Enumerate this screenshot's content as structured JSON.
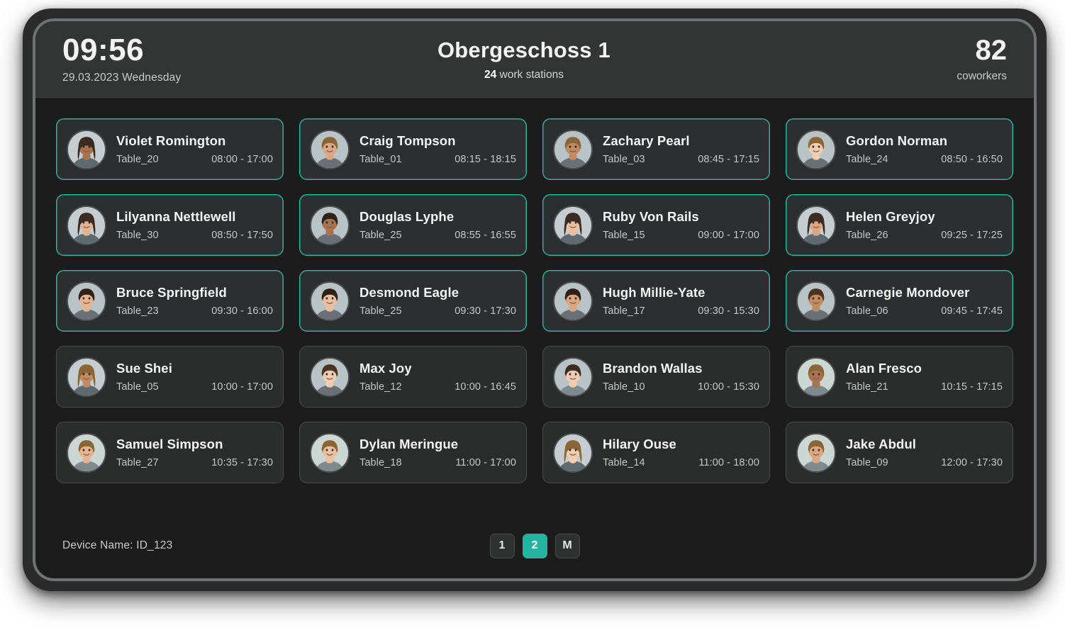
{
  "theme": {
    "accent": "#25b3a2",
    "screen_bg": "#1c1c1c",
    "header_bg": "#333434",
    "card_bg": "#2b2c2c",
    "card_border": "#4a4b4b",
    "text_primary": "#f2f2f2",
    "text_secondary": "#c9cacb"
  },
  "header": {
    "clock": "09:56",
    "date": "29.03.2023 Wednesday",
    "floor_title": "Obergeschoss 1",
    "stations_count": "24",
    "stations_suffix": " work stations",
    "coworkers_count": "82",
    "coworkers_label": "coworkers"
  },
  "footer": {
    "device_name": "Device Name: ID_123",
    "pager": [
      {
        "label": "1",
        "active": false
      },
      {
        "label": "2",
        "active": true
      },
      {
        "label": "M",
        "active": false
      }
    ]
  },
  "cards": [
    {
      "name": "Violet Romington",
      "table": "Table_20",
      "time": "08:00 - 17:00",
      "active": true,
      "avatar": "female-1"
    },
    {
      "name": "Craig Tompson",
      "table": "Table_01",
      "time": "08:15 - 18:15",
      "active": true,
      "avatar": "male-1"
    },
    {
      "name": "Zachary Pearl",
      "table": "Table_03",
      "time": "08:45 - 17:15",
      "active": true,
      "avatar": "male-2"
    },
    {
      "name": "Gordon Norman",
      "table": "Table_24",
      "time": "08:50 - 16:50",
      "active": true,
      "avatar": "male-3"
    },
    {
      "name": "Lilyanna Nettlewell",
      "table": "Table_30",
      "time": "08:50 - 17:50",
      "active": true,
      "avatar": "female-2"
    },
    {
      "name": "Douglas Lyphe",
      "table": "Table_25",
      "time": "08:55 - 16:55",
      "active": true,
      "avatar": "male-4"
    },
    {
      "name": "Ruby Von Rails",
      "table": "Table_15",
      "time": "09:00 - 17:00",
      "active": true,
      "avatar": "female-3"
    },
    {
      "name": "Helen Greyjoy",
      "table": "Table_26",
      "time": "09:25 - 17:25",
      "active": true,
      "avatar": "female-4"
    },
    {
      "name": "Bruce Springfield",
      "table": "Table_23",
      "time": "09:30 - 16:00",
      "active": true,
      "avatar": "male-5"
    },
    {
      "name": "Desmond Eagle",
      "table": "Table_25",
      "time": "09:30 - 17:30",
      "active": true,
      "avatar": "male-6"
    },
    {
      "name": "Hugh Millie-Yate",
      "table": "Table_17",
      "time": "09:30 - 15:30",
      "active": true,
      "avatar": "male-7"
    },
    {
      "name": "Carnegie Mondover",
      "table": "Table_06",
      "time": "09:45 - 17:45",
      "active": true,
      "avatar": "male-8"
    },
    {
      "name": "Sue Shei",
      "table": "Table_05",
      "time": "10:00 - 17:00",
      "active": false,
      "avatar": "female-5"
    },
    {
      "name": "Max Joy",
      "table": "Table_12",
      "time": "10:00 - 16:45",
      "active": false,
      "avatar": "male-9"
    },
    {
      "name": "Brandon Wallas",
      "table": "Table_10",
      "time": "10:00 - 15:30",
      "active": false,
      "avatar": "male-10"
    },
    {
      "name": "Alan Fresco",
      "table": "Table_21",
      "time": "10:15 - 17:15",
      "active": false,
      "avatar": "male-11"
    },
    {
      "name": "Samuel Simpson",
      "table": "Table_27",
      "time": "10:35 - 17:30",
      "active": false,
      "avatar": "male-12"
    },
    {
      "name": "Dylan Meringue",
      "table": "Table_18",
      "time": "11:00 - 17:00",
      "active": false,
      "avatar": "male-13"
    },
    {
      "name": "Hilary Ouse",
      "table": "Table_14",
      "time": "11:00 - 18:00",
      "active": false,
      "avatar": "female-6"
    },
    {
      "name": "Jake Abdul",
      "table": "Table_09",
      "time": "12:00 - 17:30",
      "active": false,
      "avatar": "male-14"
    }
  ]
}
